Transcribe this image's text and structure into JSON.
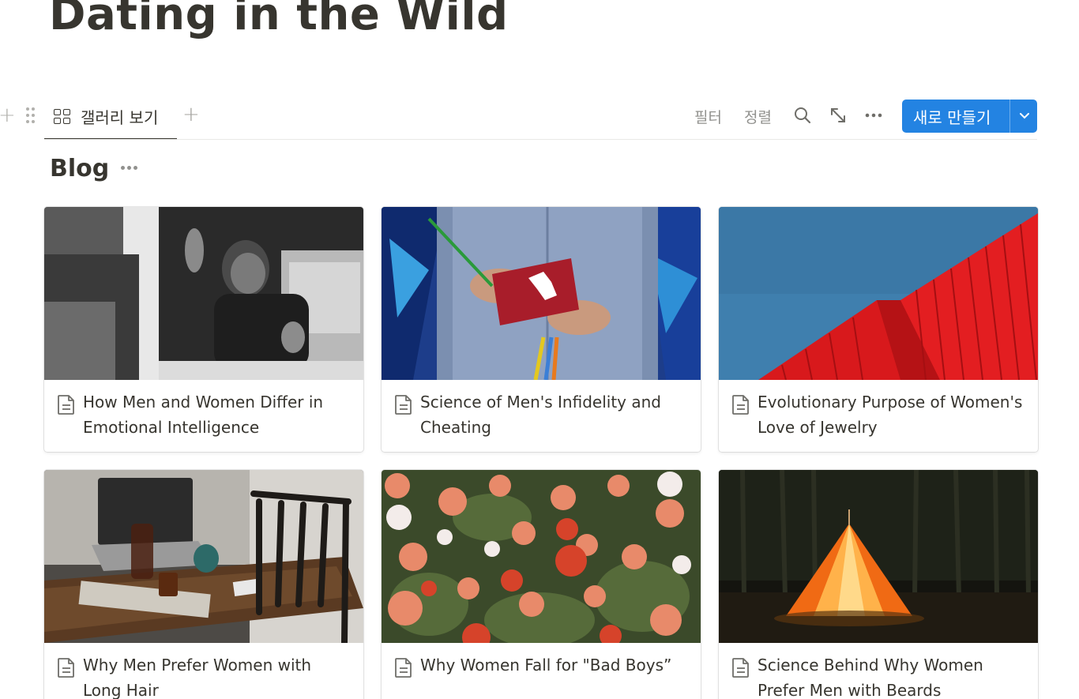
{
  "page": {
    "title": "Dating in the Wild"
  },
  "viewbar": {
    "active_tab": {
      "label": "갤러리 보기",
      "icon": "gallery-grid-icon"
    },
    "filter_label": "필터",
    "sort_label": "정렬",
    "new_button_label": "새로 만들기",
    "accent_color": "#2383e2"
  },
  "group": {
    "title": "Blog"
  },
  "cards": [
    {
      "title": "How Men and Women Differ in Emotional Intelligence",
      "cover": "black-and-white man in car making peace sign"
    },
    {
      "title": "Science of Men's Infidelity and Cheating",
      "cover": "man holding red notebook and pens"
    },
    {
      "title": "Evolutionary Purpose of Women's Love of Jewelry",
      "cover": "red building against blue sky"
    },
    {
      "title": "Why Men Prefer Women with Long Hair",
      "cover": "laptop and coffee on wooden cafe table"
    },
    {
      "title": "Why Women Fall for \"Bad Boys”",
      "cover": "field of dahlia flowers"
    },
    {
      "title": "Science Behind Why Women Prefer Men with Beards",
      "cover": "glowing tent in dark forest"
    }
  ]
}
